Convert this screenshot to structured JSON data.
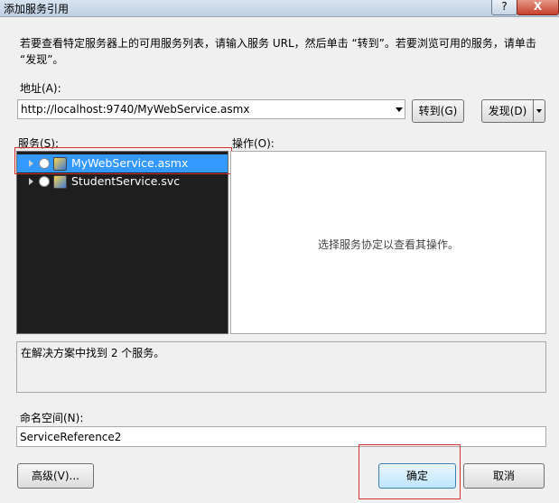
{
  "window": {
    "title": "添加服务引用",
    "help_label": "?",
    "close_label": "X"
  },
  "description": "若要查看特定服务器上的可用服务列表，请输入服务 URL，然后单击 “转到”。若要浏览可用的服务，请单击 “发现”。",
  "address": {
    "label": "地址(A):",
    "value": "http://localhost:9740/MyWebService.asmx",
    "go_button": "转到(G)",
    "discover_button": "发现(D)"
  },
  "services": {
    "label": "服务(S):",
    "items": [
      {
        "label": "MyWebService.asmx",
        "selected": true
      },
      {
        "label": "StudentService.svc",
        "selected": false
      }
    ]
  },
  "operations": {
    "label": "操作(O):",
    "empty_text": "选择服务协定以查看其操作。"
  },
  "status": {
    "text": "在解决方案中找到 2 个服务。"
  },
  "namespace": {
    "label": "命名空间(N):",
    "value": "ServiceReference2"
  },
  "footer": {
    "advanced_button": "高级(V)...",
    "ok_button": "确定",
    "cancel_button": "取消"
  },
  "colors": {
    "selection": "#3399ff",
    "highlight_box": "#d62f2f",
    "services_bg": "#1e1e1e"
  }
}
